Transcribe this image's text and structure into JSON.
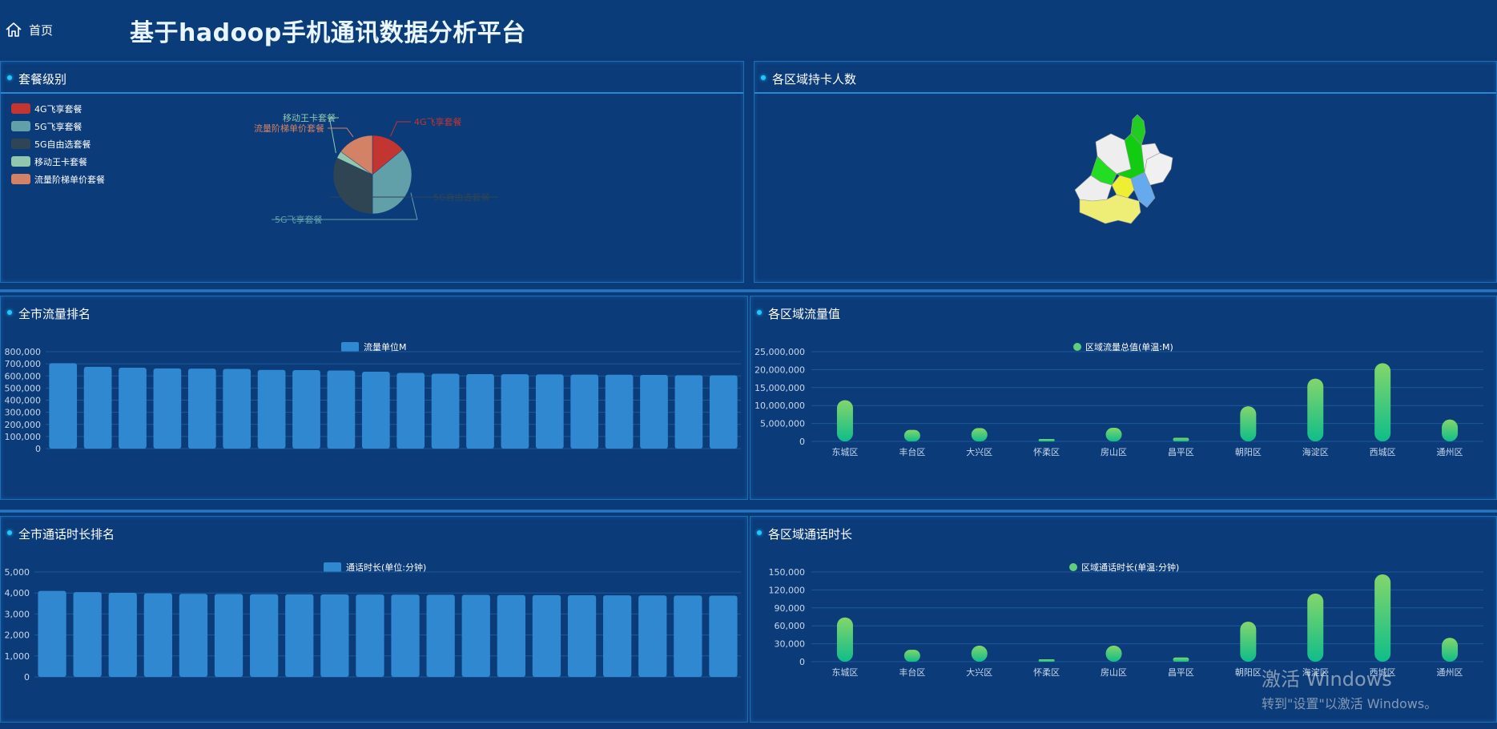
{
  "header": {
    "home_label": "首页",
    "title": "基于hadoop手机通讯数据分析平台"
  },
  "panels": {
    "package": {
      "title": "套餐级别"
    },
    "region_cards": {
      "title": "各区域持卡人数"
    },
    "city_traffic": {
      "title": "全市流量排名"
    },
    "region_traffic": {
      "title": "各区域流量值"
    },
    "city_calls": {
      "title": "全市通话时长排名"
    },
    "region_calls": {
      "title": "各区域通话时长"
    }
  },
  "colors": {
    "red": "#c23531",
    "teal": "#61a0a8",
    "dark": "#2f4554",
    "mint": "#91c7ae",
    "salmon": "#d48265",
    "bar": "#2f88d0"
  },
  "pie_chart": {
    "type": "pie",
    "legend": [
      "4G飞享套餐",
      "5G飞享套餐",
      "5G自由选套餐",
      "移动王卡套餐",
      "流量阶梯单价套餐"
    ],
    "labels": [
      "4G飞享套餐",
      "5G飞享套餐",
      "5G自由选套餐",
      "移动王卡套餐",
      "流量阶梯单价套餐"
    ],
    "values": [
      14,
      36,
      32,
      3,
      15
    ],
    "colors": [
      "#c23531",
      "#61a0a8",
      "#2f4554",
      "#91c7ae",
      "#d48265"
    ]
  },
  "chart_data": [
    {
      "type": "bar",
      "legend": "流量单位M",
      "yticks": [
        "800,000",
        "700,000",
        "600,000",
        "500,000",
        "400,000",
        "300,000",
        "200,000",
        "100,000",
        "0"
      ],
      "ylim": [
        0,
        800000
      ],
      "values": [
        705000,
        675000,
        668000,
        662000,
        660000,
        658000,
        650000,
        648000,
        645000,
        635000,
        625000,
        618000,
        615000,
        614000,
        612000,
        611000,
        610000,
        608000,
        606000,
        605000
      ]
    },
    {
      "type": "bar",
      "legend": "区域流量总值(单温:M)",
      "categories": [
        "东城区",
        "丰台区",
        "大兴区",
        "怀柔区",
        "房山区",
        "昌平区",
        "朝阳区",
        "海淀区",
        "西城区",
        "通州区"
      ],
      "yticks": [
        "25,000,000",
        "20,000,000",
        "15,000,000",
        "10,000,000",
        "5,000,000",
        "0"
      ],
      "ylim": [
        0,
        25000000
      ],
      "values": [
        11500000,
        3200000,
        3700000,
        400000,
        3800000,
        1000000,
        9800000,
        17500000,
        21800000,
        6100000
      ]
    },
    {
      "type": "bar",
      "legend": "通话时长(单位:分钟)",
      "yticks": [
        "5,000",
        "4,000",
        "3,000",
        "2,000",
        "1,000",
        "0"
      ],
      "ylim": [
        0,
        5000
      ],
      "values": [
        4100,
        4040,
        4010,
        3980,
        3960,
        3950,
        3940,
        3935,
        3930,
        3925,
        3920,
        3915,
        3910,
        3905,
        3900,
        3895,
        3890,
        3885,
        3880,
        3875
      ]
    },
    {
      "type": "bar",
      "legend": "区域通话时长(单温:分钟)",
      "categories": [
        "东城区",
        "丰台区",
        "大兴区",
        "怀柔区",
        "房山区",
        "昌平区",
        "朝阳区",
        "海淀区",
        "西城区",
        "通州区"
      ],
      "yticks": [
        "150,000",
        "120,000",
        "90,000",
        "60,000",
        "30,000",
        "0"
      ],
      "ylim": [
        0,
        150000
      ],
      "values": [
        74000,
        20000,
        27000,
        3500,
        27000,
        7000,
        67000,
        114000,
        146000,
        40000
      ]
    }
  ],
  "watermark": {
    "line1": "激活 Windows",
    "line2": "转到\"设置\"以激活 Windows。"
  }
}
